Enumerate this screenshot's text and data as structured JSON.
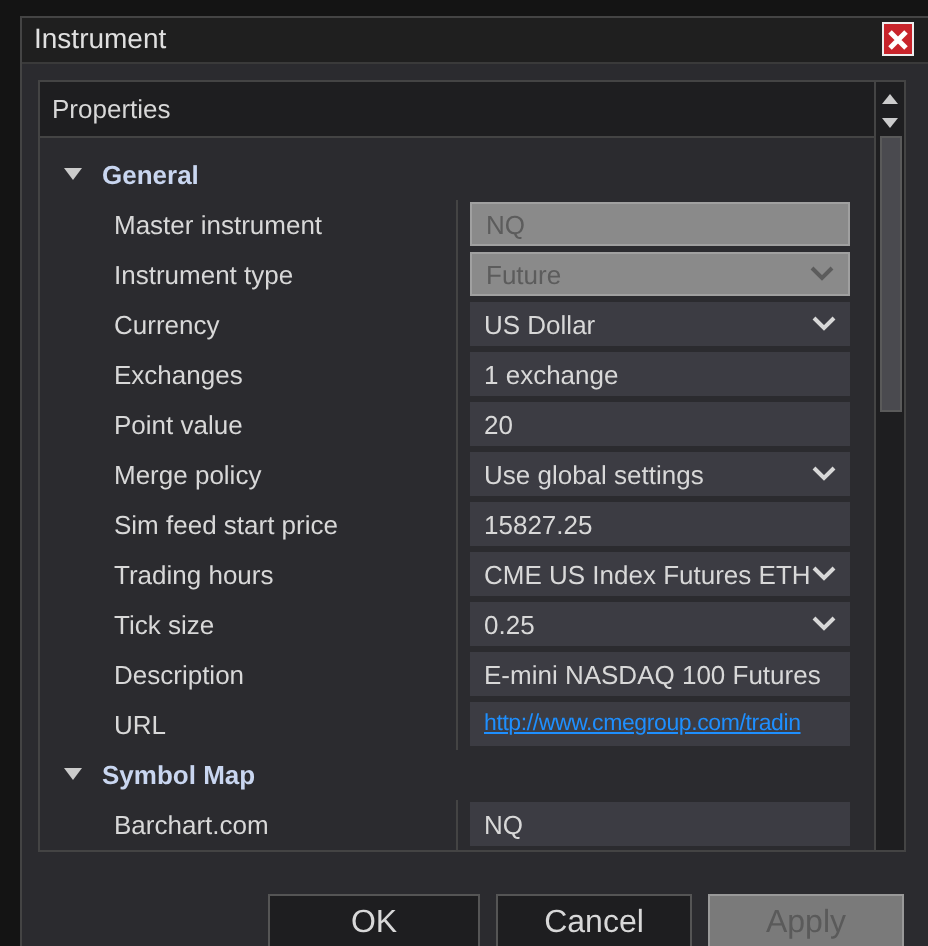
{
  "window": {
    "title": "Instrument"
  },
  "panel": {
    "title": "Properties"
  },
  "sections": [
    {
      "title": "General",
      "expanded": true,
      "rows": [
        {
          "label": "Master instrument",
          "kind": "text",
          "value": "NQ",
          "disabled": true
        },
        {
          "label": "Instrument type",
          "kind": "dropdown",
          "value": "Future",
          "disabled": true
        },
        {
          "label": "Currency",
          "kind": "dropdown",
          "value": "US Dollar",
          "disabled": false
        },
        {
          "label": "Exchanges",
          "kind": "text",
          "value": "1 exchange",
          "disabled": false
        },
        {
          "label": "Point value",
          "kind": "text",
          "value": "20",
          "disabled": false
        },
        {
          "label": "Merge policy",
          "kind": "dropdown",
          "value": "Use global settings",
          "disabled": false
        },
        {
          "label": "Sim feed start price",
          "kind": "text",
          "value": "15827.25",
          "disabled": false
        },
        {
          "label": "Trading hours",
          "kind": "dropdown",
          "value": "CME US Index Futures ETH",
          "disabled": false
        },
        {
          "label": "Tick size",
          "kind": "dropdown",
          "value": "0.25",
          "disabled": false
        },
        {
          "label": "Description",
          "kind": "text",
          "value": "E-mini NASDAQ 100 Futures",
          "disabled": false
        },
        {
          "label": "URL",
          "kind": "link",
          "value": "http://www.cmegroup.com/tradin",
          "disabled": false
        }
      ]
    },
    {
      "title": "Symbol Map",
      "expanded": true,
      "rows": [
        {
          "label": "Barchart.com",
          "kind": "text",
          "value": "NQ",
          "disabled": false
        }
      ]
    }
  ],
  "buttons": [
    {
      "label": "OK",
      "disabled": false
    },
    {
      "label": "Cancel",
      "disabled": false
    },
    {
      "label": "Apply",
      "disabled": true
    }
  ]
}
